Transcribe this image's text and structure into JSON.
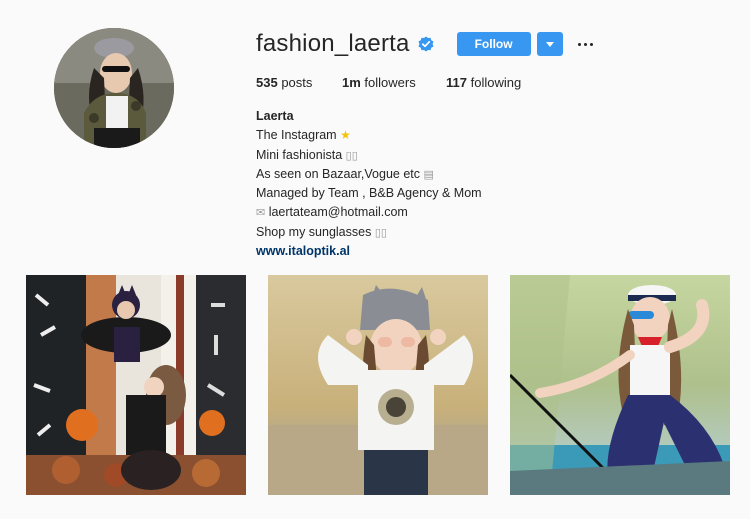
{
  "profile": {
    "username": "fashion_laerta",
    "verified": true,
    "follow_label": "Follow",
    "avatar_icon": "profile-photo"
  },
  "stats": {
    "posts_count": "535",
    "posts_label": "posts",
    "followers_count": "1m",
    "followers_label": "followers",
    "following_count": "117",
    "following_label": "following"
  },
  "bio": {
    "name": "Laerta",
    "line1": "The Instagram",
    "line2": "Mini fashionista",
    "line3": "As seen on Bazaar,Vogue etc",
    "line4": "Managed by Team , B&B Agency & Mom",
    "line5": "laertateam@hotmail.com",
    "line6": "Shop my sunglasses",
    "link": "www.italoptik.al"
  },
  "colors": {
    "accent": "#3897f0",
    "link": "#003569",
    "background": "#fafafa"
  },
  "icons": {
    "verified": "verified-badge-icon",
    "dropdown": "chevron-down-icon",
    "more": "more-options-icon",
    "star": "star-icon",
    "newspaper": "newspaper-icon",
    "envelope": "envelope-icon"
  }
}
